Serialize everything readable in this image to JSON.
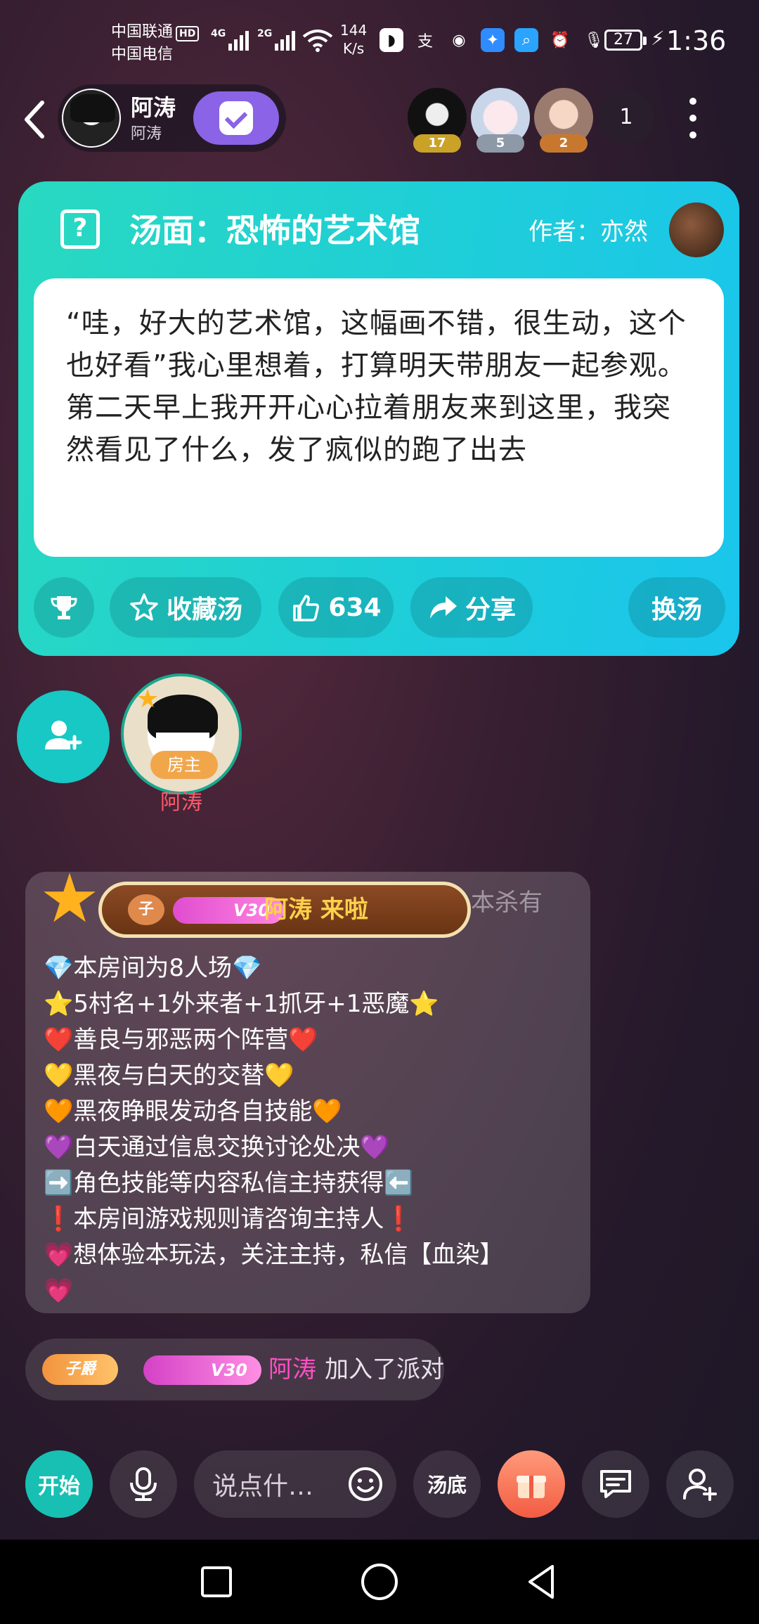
{
  "status_bar": {
    "carrier1": "中国联通",
    "carrier1_badge": "HD",
    "carrier2": "中国电信",
    "signal1_label": "4G",
    "signal2_label": "2G",
    "speed_value": "144",
    "speed_unit": "K/s",
    "battery": "27",
    "time": "1:36"
  },
  "header": {
    "host_name": "阿涛",
    "host_sub": "阿涛",
    "viewers": [
      {
        "badge": "17",
        "badge_color": "#c9a227"
      },
      {
        "badge": "5",
        "badge_color": "#8e99a8"
      },
      {
        "badge": "2",
        "badge_color": "#c8782e"
      }
    ],
    "viewer_count": "1"
  },
  "soup_card": {
    "title": "汤面：恐怖的艺术馆",
    "author_label": "作者：亦然",
    "text": "“哇，好大的艺术馆，这幅画不错，很生动，这个也好看”我心里想着，打算明天带朋友一起参观。第二天早上我开开心心拉着朋友来到这里，我突然看见了什么，发了疯似的跑了出去",
    "collect_label": "收藏汤",
    "like_count": "634",
    "share_label": "分享",
    "change_label": "换汤"
  },
  "seats": {
    "host_tag": "房主",
    "host_name": "阿涛"
  },
  "chat": {
    "behind_text": "本杀有",
    "welcome": {
      "rank_label": "子",
      "vip_label": "V30",
      "text": "阿涛 来啦"
    },
    "rules": [
      "💎本房间为8人场💎",
      "⭐5村名+1外来者+1抓牙+1恶魔⭐",
      "❤️善良与邪恶两个阵营❤️",
      "💛黑夜与白天的交替💛",
      "🧡黑夜睁眼发动各自技能🧡",
      "💜白天通过信息交换讨论处决💜",
      "➡️角色技能等内容私信主持获得⬅️",
      "❗本房间游戏规则请咨询主持人❗",
      "💗想体验本玩法，关注主持，私信【血染】",
      "💗"
    ],
    "join": {
      "rank_label": "子爵",
      "vip_label": "V30",
      "name": "阿涛",
      "text": "加入了派对"
    }
  },
  "toolbar": {
    "start_label": "开始",
    "input_placeholder": "说点什…",
    "soup_base_label": "汤底"
  }
}
